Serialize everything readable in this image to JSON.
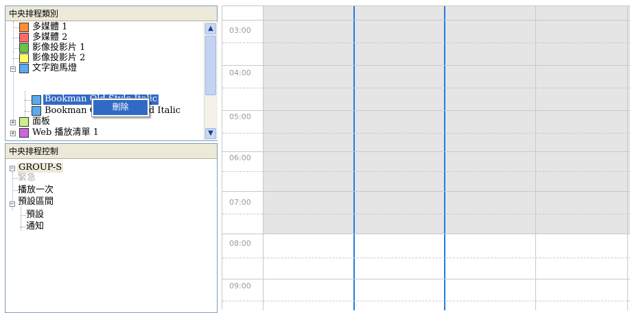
{
  "category_panel": {
    "title": "中央排程類別",
    "items": [
      {
        "label": "多媒體 1",
        "color": "#ff8c3a"
      },
      {
        "label": "多媒體 2",
        "color": "#ff6b6b"
      },
      {
        "label": "影像投影片 1",
        "color": "#6cc24a"
      },
      {
        "label": "影像投影片 2",
        "color": "#ffff66"
      },
      {
        "label": "文字跑馬燈",
        "color": "#5aaaf0",
        "expanded": true
      },
      {
        "label": "Bookman Old Style Italic",
        "color": "#5aaaf0",
        "selected": true
      },
      {
        "label": "Bookman Old Style Bold Italic",
        "color": "#5aaaf0"
      },
      {
        "label": "面板",
        "color": "#ccee88"
      },
      {
        "label": "Web 播放清單 1",
        "color": "#cc66dd"
      }
    ]
  },
  "context_menu": {
    "items": [
      {
        "label": "刪除"
      }
    ]
  },
  "control_panel": {
    "title": "中央排程控制",
    "root": "GROUP-S",
    "children": [
      {
        "label": "緊急",
        "disabled": true
      },
      {
        "label": "播放一次"
      },
      {
        "label": "預設區間",
        "expanded": true,
        "children": [
          {
            "label": "預設"
          },
          {
            "label": "通知"
          }
        ]
      }
    ]
  },
  "calendar": {
    "times": [
      "03:00",
      "04:00",
      "05:00",
      "06:00",
      "07:00",
      "08:00",
      "09:00"
    ],
    "busy_hours_end": "08:00",
    "busy_color": "#e5e5e5",
    "separator_color": "#1e7be0"
  }
}
